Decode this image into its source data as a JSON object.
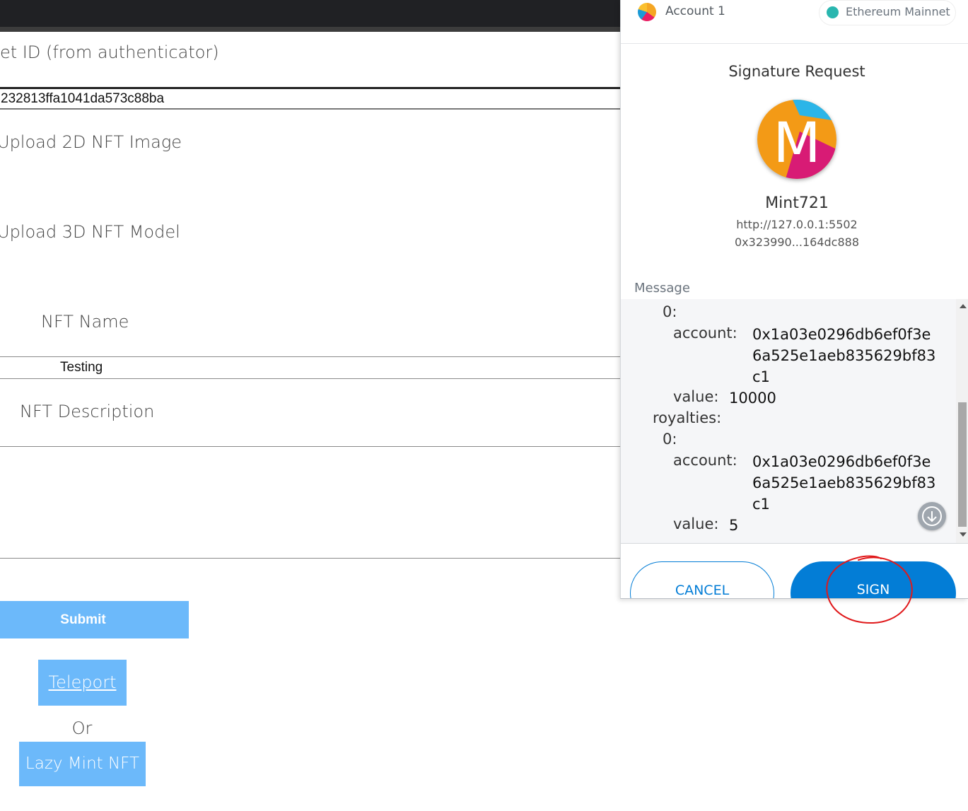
{
  "page": {
    "asset_id_label": "et ID (from authenticator)",
    "asset_id_value": "232813ffa1041da573c88ba",
    "upload_2d_label": "Upload 2D NFT Image",
    "upload_3d_label": "Upload 3D NFT Model",
    "nft_name_label": "NFT Name",
    "nft_name_value": "Testing",
    "nft_description_label": "NFT Description",
    "submit_label": "Submit",
    "teleport_label": "Teleport",
    "or_text": "Or",
    "lazy_mint_label": "Lazy Mint NFT"
  },
  "popup": {
    "account_name": "Account 1",
    "network_name": "Ethereum Mainnet",
    "title": "Signature Request",
    "site_icon_letter": "M",
    "site_name": "Mint721",
    "site_url": "http://127.0.0.1:5502",
    "site_address": "0x323990...164dc888",
    "message_label": "Message",
    "message": {
      "index_1": "0:",
      "account_key_1": "account:",
      "account_value_1": [
        "0x1a03e0296db6ef0f3e",
        "6a525e1aeb835629bf83",
        "c1"
      ],
      "value_key_1": "value:",
      "value_value_1": "10000",
      "royalties_key": "royalties:",
      "index_2": "0:",
      "account_key_2": "account:",
      "account_value_2": [
        "0x1a03e0296db6ef0f3e",
        "6a525e1aeb835629bf83",
        "c1"
      ],
      "value_key_2": "value:",
      "value_value_2": "5"
    },
    "cancel_label": "CANCEL",
    "sign_label": "SIGN"
  },
  "colors": {
    "page_button_bg": "#6cb9fa",
    "metamask_blue": "#037dd6",
    "network_dot": "#29b6af",
    "annotation_red": "#e0191b"
  }
}
